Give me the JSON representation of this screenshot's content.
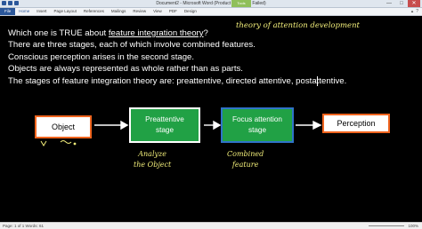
{
  "window": {
    "title": "Document2 - Microsoft Word (Product Activation Failed)",
    "tools_tab": "Tools",
    "controls": [
      "—",
      "□",
      "✕"
    ]
  },
  "ribbon": {
    "file_label": "File",
    "tabs": [
      "Home",
      "Insert",
      "Page Layout",
      "References",
      "Mailings",
      "Review",
      "View",
      "PDF",
      "Design"
    ]
  },
  "question": {
    "line1_pre": "Which one is TRUE about ",
    "line1_link": "feature integration theory",
    "line1_post": "?",
    "line2": "There are three stages, each of which involve combined features.",
    "line3": "Conscious perception arises in the second stage.",
    "line4": "Objects are always represented as whole rather than as parts.",
    "line5": "The stages of feature integration theory are: preattentive, directed attentive, postattentive."
  },
  "handwriting": {
    "theory": "theory of attention development",
    "analyze_line1": "Analyze",
    "analyze_line2": "the Object",
    "combined_line1": "Combined",
    "combined_line2": "feature"
  },
  "diagram": {
    "object": "Object",
    "preattentive_line1": "Preattentive",
    "preattentive_line2": "stage",
    "focus_line1": "Focus attention",
    "focus_line2": "stage",
    "perception": "Perception"
  },
  "status": {
    "left": "Page: 1 of 1   Words: 61",
    "zoom": "100%"
  },
  "colors": {
    "background": "#000000",
    "stage_green": "#21a145",
    "box_border_orange": "#f0641e",
    "focus_border_blue": "#2f73c8",
    "handwriting_yellow": "#f2ee7a"
  }
}
